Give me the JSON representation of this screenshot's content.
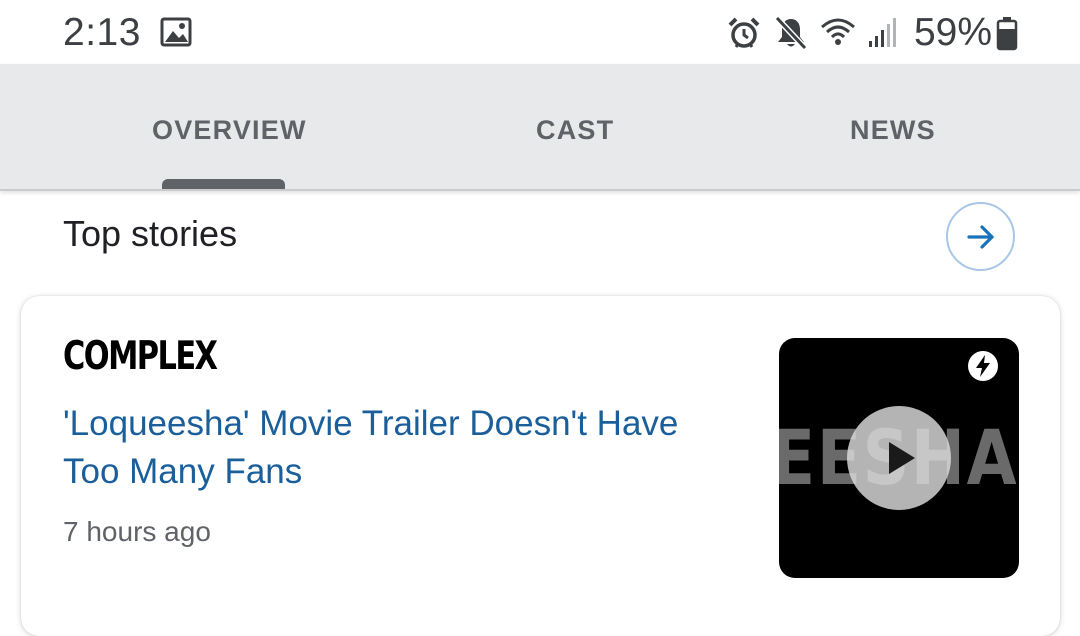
{
  "status_bar": {
    "time": "2:13",
    "battery_percent": "59%",
    "icons": [
      "gallery-icon",
      "alarm-icon",
      "mute-icon",
      "wifi-icon",
      "signal-icon",
      "battery-icon"
    ]
  },
  "tabs": [
    {
      "label": "OVERVIEW",
      "selected": true
    },
    {
      "label": "CAST",
      "selected": false
    },
    {
      "label": "NEWS",
      "selected": false
    }
  ],
  "top_stories": {
    "title": "Top stories",
    "more_icon": "arrow-right-icon",
    "stories": [
      {
        "publisher": "COMPLEX",
        "headline": "'Loqueesha' Movie Trailer Doesn't Have Too Many Fans",
        "time": "7 hours ago",
        "thumbnail_text": "EESHA",
        "thumbnail_icons": [
          "play-icon",
          "amp-bolt-icon"
        ]
      }
    ]
  },
  "colors": {
    "accent_link": "#1a5e9a",
    "tab_bar_bg": "#e8e9eb",
    "tab_text": "#5f6368",
    "circle_border": "#a8c7e6"
  }
}
